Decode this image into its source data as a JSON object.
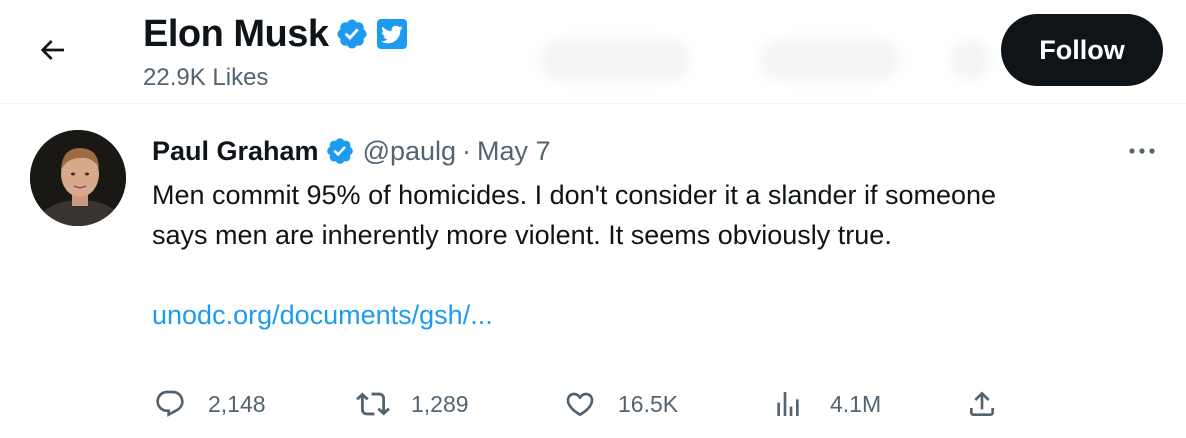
{
  "header": {
    "profile_name": "Elon Musk",
    "likes_count": "22.9K Likes",
    "follow_label": "Follow",
    "back_icon": "arrow-left-icon",
    "verified_icon": "verified-badge-icon",
    "affiliate_icon": "twitter-bird-icon"
  },
  "tweet": {
    "author_name": "Paul Graham",
    "author_handle": "@paulg",
    "separator": "·",
    "date": "May 7",
    "text_lines": [
      "Men commit 95% of homicides. I don't consider it a slander if someone",
      "says men are inherently more violent. It seems obviously true."
    ],
    "link": "unodc.org/documents/gsh/...",
    "more_icon": "more-horizontal-icon"
  },
  "actions": {
    "replies": {
      "icon": "reply-icon",
      "count": "2,148"
    },
    "retweets": {
      "icon": "retweet-icon",
      "count": "1,289"
    },
    "likes": {
      "icon": "heart-icon",
      "count": "16.5K"
    },
    "views": {
      "icon": "analytics-icon",
      "count": "4.1M"
    },
    "share": {
      "icon": "share-icon"
    }
  },
  "colors": {
    "accent": "#1d9bf0",
    "text_primary": "#0f1419",
    "text_secondary": "#536471",
    "divider": "#eff3f4"
  }
}
